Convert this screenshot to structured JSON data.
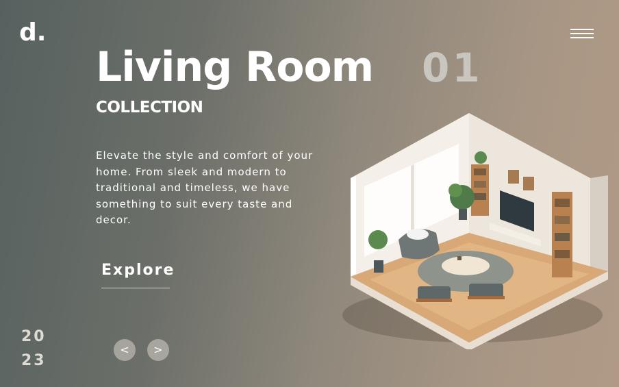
{
  "brand": {
    "logo": "d."
  },
  "hero": {
    "title": "Living Room",
    "slide_number": "01",
    "subtitle": "COLLECTION",
    "description": "Elevate the style and comfort of your home. From sleek and modern to traditional and timeless, we have something to suit every taste and decor.",
    "cta_label": "Explore"
  },
  "year": {
    "line1": "20",
    "line2": "23"
  },
  "carousel": {
    "prev_label": "<",
    "next_label": ">"
  },
  "icons": {
    "menu": "hamburger-menu-icon",
    "prev": "chevron-left-icon",
    "next": "chevron-right-icon"
  },
  "colors": {
    "accent_text": "#ffffff",
    "muted_number": "#c9c6c0"
  }
}
